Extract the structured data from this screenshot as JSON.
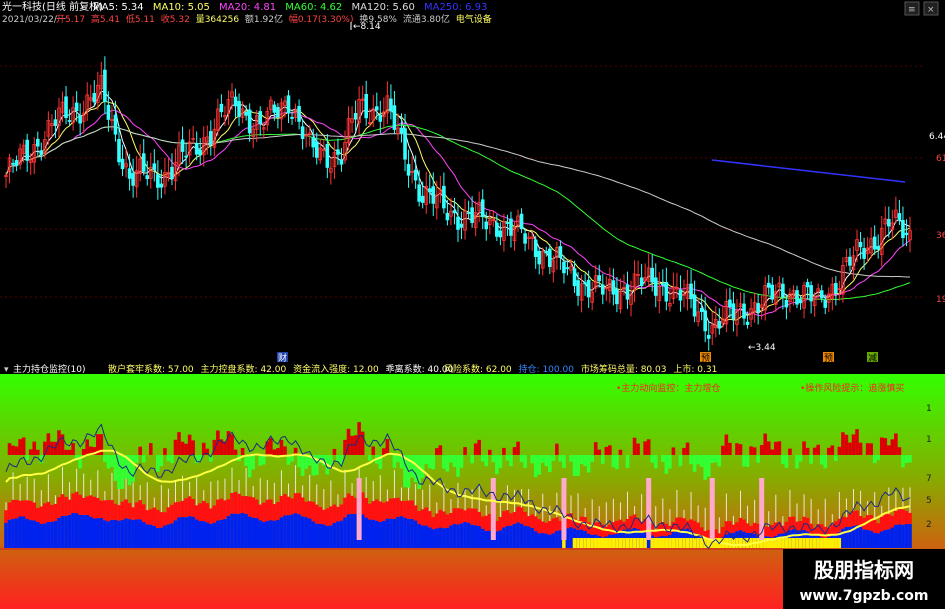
{
  "header": {
    "title": "光一科技(日线 前复权)",
    "ma": [
      {
        "label": "MA5: 5.34",
        "color": "#ffffff"
      },
      {
        "label": "MA10: 5.05",
        "color": "#ffff66"
      },
      {
        "label": "MA20: 4.81",
        "color": "#ff44ff"
      },
      {
        "label": "MA60: 4.62",
        "color": "#33ff33"
      },
      {
        "label": "MA120: 5.60",
        "color": "#dddddd"
      },
      {
        "label": "MA250: 6.93",
        "color": "#3333ff"
      }
    ],
    "date": "2021/03/22/一",
    "info": [
      {
        "label": "开5.17",
        "color": "#ff4444"
      },
      {
        "label": "高5.41",
        "color": "#ff4444"
      },
      {
        "label": "低5.11",
        "color": "#ff4444"
      },
      {
        "label": "收5.32",
        "color": "#ff4444"
      },
      {
        "label": "量364256",
        "color": "#ffff66"
      },
      {
        "label": "额1.92亿",
        "color": "#cccccc"
      },
      {
        "label": "幅0.17(3.30%)",
        "color": "#ff4444"
      },
      {
        "label": "换9.58%",
        "color": "#cccccc"
      },
      {
        "label": "流通3.80亿",
        "color": "#cccccc"
      },
      {
        "label": "电气设备",
        "color": "#ffff66"
      }
    ]
  },
  "price_axis_labels": [
    "6.44",
    "61",
    "36",
    "19"
  ],
  "annotations": {
    "high": "8.14",
    "low": "3.44",
    "markers": [
      "财",
      "预",
      "预",
      "减"
    ]
  },
  "indicator": {
    "title": "主力持仓监控(10)",
    "params": [
      {
        "label": "散户套牢系数: 57.00",
        "color": "#ffff66"
      },
      {
        "label": "主力控盘系数: 42.00",
        "color": "#ffff66"
      },
      {
        "label": "资金流入强度: 12.00",
        "color": "#ffff66"
      },
      {
        "label": "乖离系数: 40.00",
        "color": "#ffffff"
      },
      {
        "label": "风险系数: 62.00",
        "color": "#ffff66"
      },
      {
        "label": "持仓: 100.00",
        "color": "#3388ff"
      },
      {
        "label": "市场筹码总量: 80.03",
        "color": "#ffff66"
      },
      {
        "label": "上市: 0.31",
        "color": "#ffff66"
      }
    ],
    "msg1": "主力动向监控：主力增仓",
    "msg2": "操作风险提示：追涨慎买",
    "axis_labels": [
      "1",
      "1",
      "7",
      "5",
      "2"
    ]
  },
  "watermark": {
    "cn": "股朋指标网",
    "url": "www.7gpzb.com"
  },
  "chart_data": {
    "type": "candlestick",
    "title": "光一科技(日线 前复权)",
    "anchors": [
      {
        "x": 0,
        "y": 5.05
      },
      {
        "x": 15,
        "y": 6.3
      },
      {
        "x": 27,
        "y": 6.9
      },
      {
        "x": 35,
        "y": 5.0
      },
      {
        "x": 45,
        "y": 5.1
      },
      {
        "x": 55,
        "y": 5.8
      },
      {
        "x": 65,
        "y": 6.7
      },
      {
        "x": 72,
        "y": 6.1
      },
      {
        "x": 80,
        "y": 6.8
      },
      {
        "x": 86,
        "y": 5.6
      },
      {
        "x": 95,
        "y": 5.5
      },
      {
        "x": 100,
        "y": 6.6
      },
      {
        "x": 108,
        "y": 6.5
      },
      {
        "x": 118,
        "y": 4.6
      },
      {
        "x": 130,
        "y": 4.1
      },
      {
        "x": 140,
        "y": 4.0
      },
      {
        "x": 150,
        "y": 3.5
      },
      {
        "x": 160,
        "y": 2.8
      },
      {
        "x": 170,
        "y": 2.4
      },
      {
        "x": 178,
        "y": 2.65
      },
      {
        "x": 186,
        "y": 2.6
      },
      {
        "x": 192,
        "y": 2.3
      },
      {
        "x": 200,
        "y": 1.7
      },
      {
        "x": 210,
        "y": 2.1
      },
      {
        "x": 222,
        "y": 2.5
      },
      {
        "x": 230,
        "y": 2.2
      },
      {
        "x": 238,
        "y": 3.0
      },
      {
        "x": 244,
        "y": 3.5
      },
      {
        "x": 250,
        "y": 4.0
      },
      {
        "x": 256,
        "y": 3.7
      }
    ],
    "y_range": [
      1.2,
      8.3
    ],
    "points": 257
  }
}
